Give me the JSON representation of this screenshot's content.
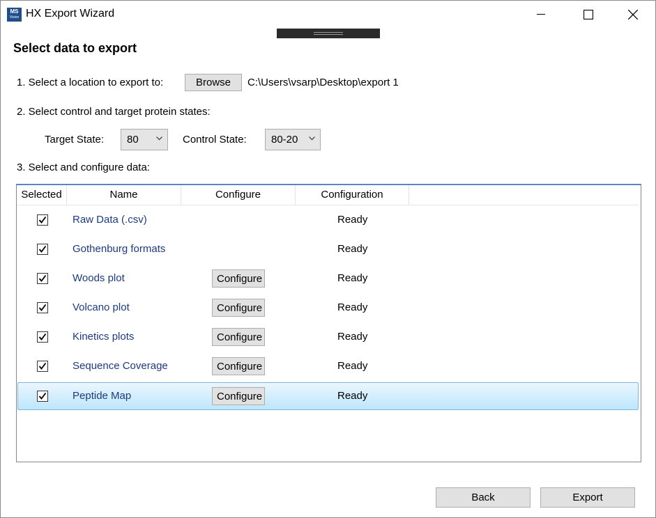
{
  "window": {
    "title": "HX Export Wizard",
    "app_icon_text": "MS",
    "app_icon_sub": "Vision"
  },
  "page": {
    "heading": "Select data to export",
    "step1_label": "1. Select a location to export to:",
    "browse_label": "Browse",
    "export_path": "C:\\Users\\vsarp\\Desktop\\export 1",
    "step2_label": "2. Select control and target protein states:",
    "target_state_label": "Target State:",
    "target_state_value": "80",
    "control_state_label": "Control State:",
    "control_state_value": "80-20",
    "step3_label": "3. Select and configure data:"
  },
  "grid": {
    "columns": [
      "Selected",
      "Name",
      "Configure",
      "Configuration"
    ],
    "rows": [
      {
        "name": "Raw Data (.csv)",
        "checked": true,
        "configure": "",
        "status": "Ready"
      },
      {
        "name": "Gothenburg formats",
        "checked": true,
        "configure": "",
        "status": "Ready"
      },
      {
        "name": "Woods plot",
        "checked": true,
        "configure": "Configure",
        "status": "Ready"
      },
      {
        "name": "Volcano plot",
        "checked": true,
        "configure": "Configure",
        "status": "Ready"
      },
      {
        "name": "Kinetics plots",
        "checked": true,
        "configure": "Configure",
        "status": "Ready"
      },
      {
        "name": "Sequence Coverage",
        "checked": true,
        "configure": "Configure",
        "status": "Ready"
      },
      {
        "name": "Peptide Map",
        "checked": true,
        "configure": "Configure",
        "status": "Ready",
        "selected": true
      }
    ]
  },
  "footer": {
    "back_label": "Back",
    "export_label": "Export"
  }
}
